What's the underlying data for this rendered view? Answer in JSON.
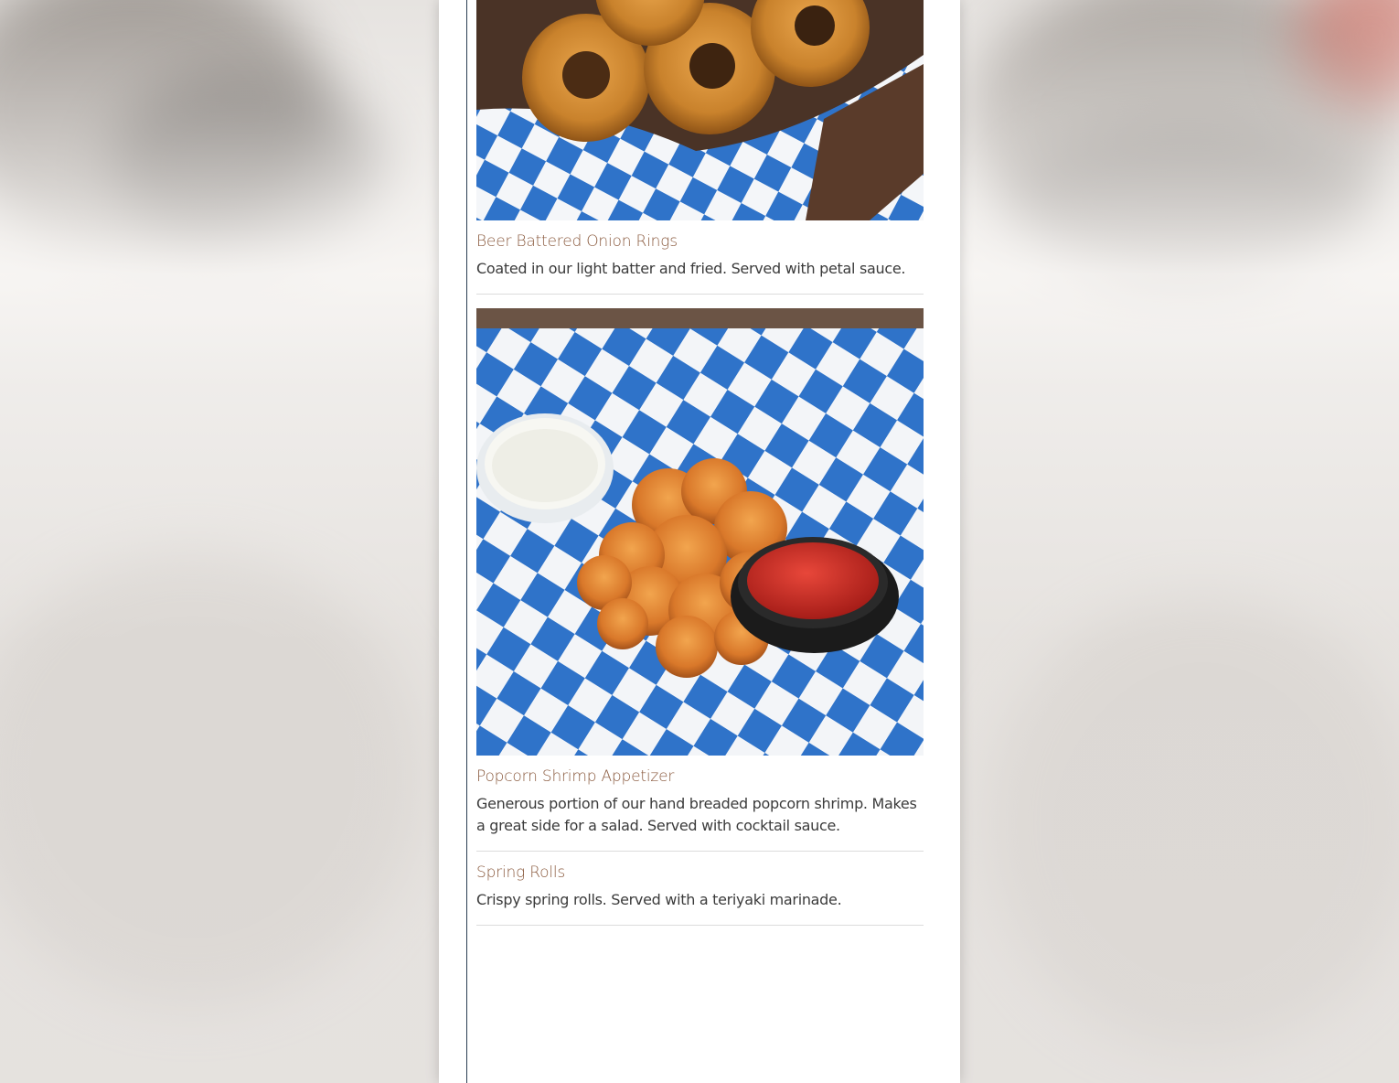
{
  "menu": {
    "items": [
      {
        "name": "Beer Battered Onion Rings",
        "description": "Coated in our light batter and fried. Served with petal sauce.",
        "image": "onion-rings-photo"
      },
      {
        "name": "Popcorn Shrimp Appetizer",
        "description": "Generous portion of our hand breaded popcorn shrimp. Makes a great side for a salad. Served with cocktail sauce.",
        "image": "popcorn-shrimp-photo"
      },
      {
        "name": "Spring Rolls",
        "description": "Crispy spring rolls. Served with a teriyaki marinade."
      }
    ]
  },
  "colors": {
    "item_name": "#8a5a3e",
    "description": "#3b3b3b",
    "checker_blue": "#2f73c9",
    "rule": "#2b3e52"
  }
}
